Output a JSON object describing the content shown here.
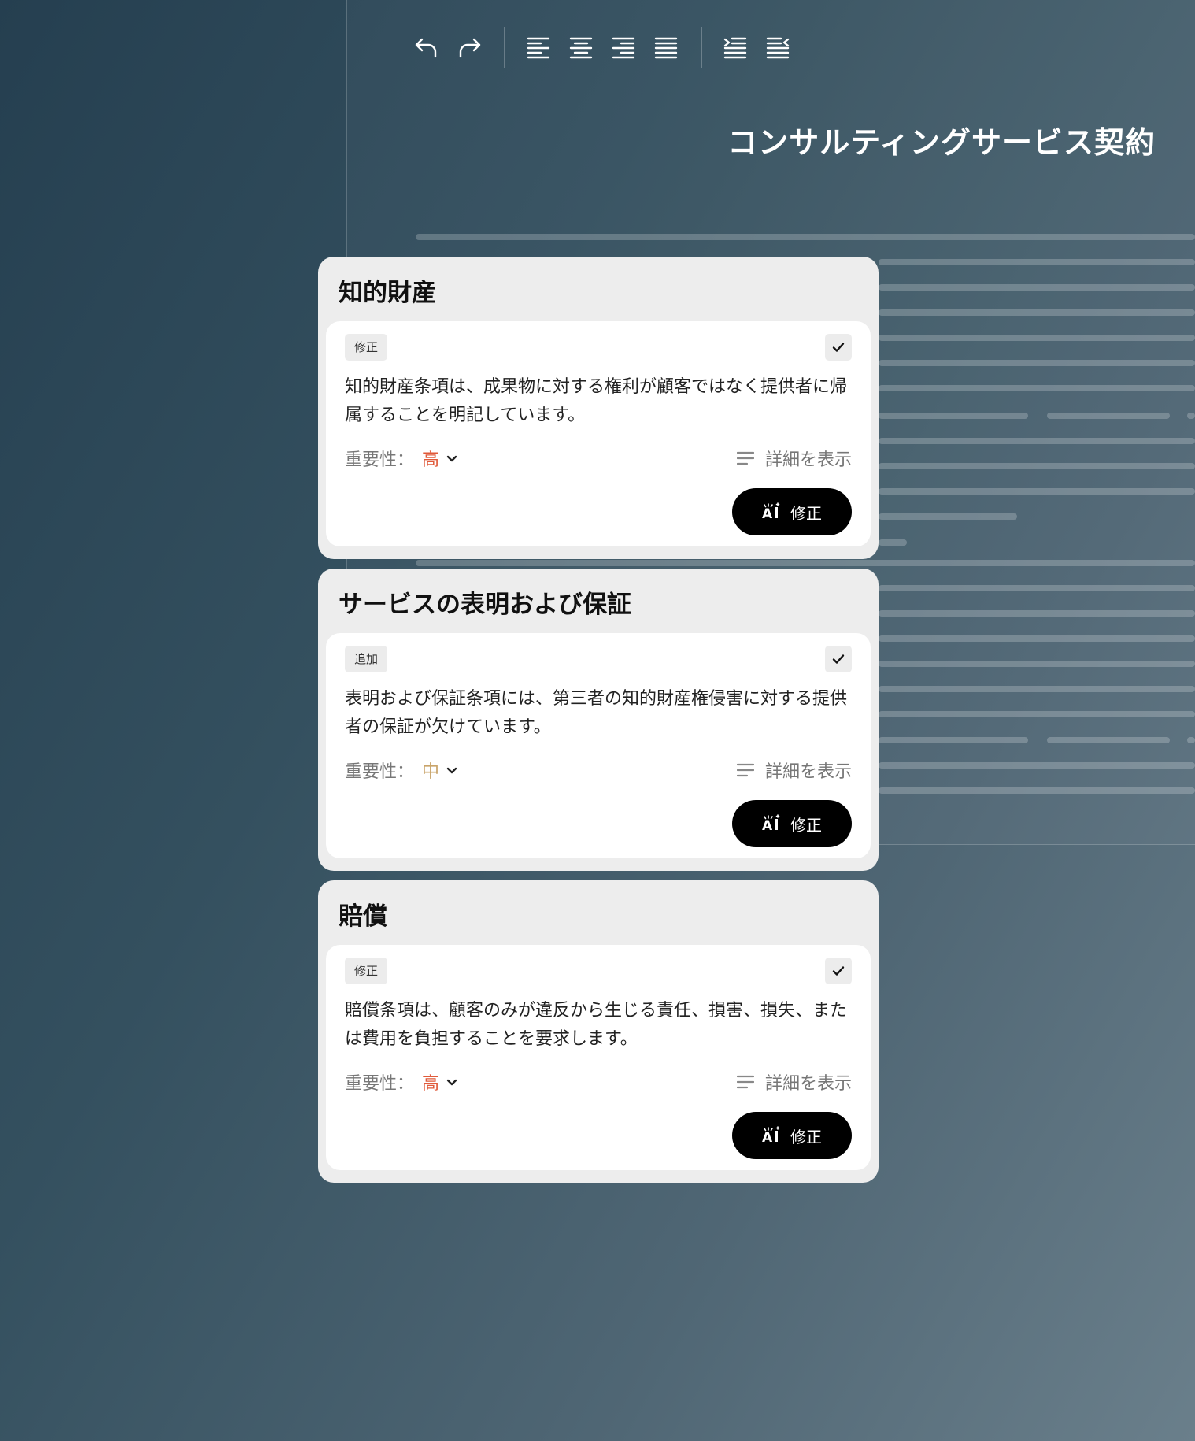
{
  "document": {
    "title": "コンサルティングサービス契約"
  },
  "colors": {
    "severity_high": "#e05a3a",
    "severity_medium": "#c9a46a",
    "button_bg": "#000000"
  },
  "toolbar": {
    "buttons": [
      "undo-icon",
      "redo-icon",
      "align-left-icon",
      "align-center-icon",
      "align-right-icon",
      "align-justify-icon",
      "indent-icon",
      "outdent-icon"
    ]
  },
  "issues": [
    {
      "section": "知的財産",
      "tag": "修正",
      "description": "知的財産条項は、成果物に対する権利が顧客ではなく提供者に帰属することを明記しています。",
      "importance_label": "重要性：",
      "importance_value": "高",
      "details_label": "詳細を表示",
      "action_label": "修正"
    },
    {
      "section": "サービスの表明および保証",
      "tag": "追加",
      "description": "表明および保証条項には、第三者の知的財産権侵害に対する提供者の保証が欠けています。",
      "importance_label": "重要性：",
      "importance_value": "中",
      "details_label": "詳細を表示",
      "action_label": "修正"
    },
    {
      "section": "賠償",
      "tag": "修正",
      "description": "賠償条項は、顧客のみが違反から生じる責任、損害、損失、または費用を負担することを要求します。",
      "importance_label": "重要性：",
      "importance_value": "高",
      "details_label": "詳細を表示",
      "action_label": "修正"
    }
  ]
}
